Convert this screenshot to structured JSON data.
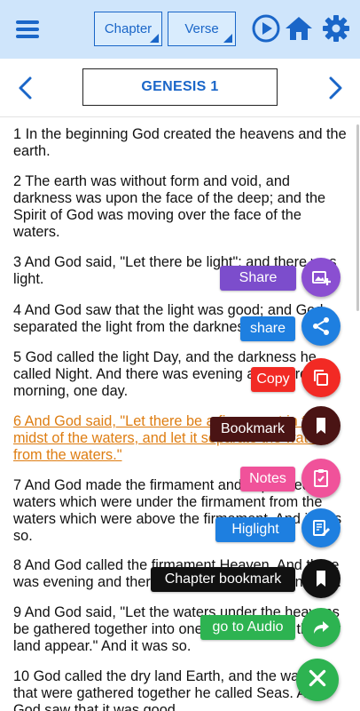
{
  "toolbar": {
    "chapter_label": "Chapter",
    "verse_label": "Verse",
    "icons": [
      "menu-icon",
      "play-circle-icon",
      "home-icon",
      "gear-icon"
    ]
  },
  "nav": {
    "title": "GENESIS 1",
    "icons": [
      "chevron-left-icon",
      "chevron-right-icon"
    ]
  },
  "verses": [
    {
      "lines": [
        "1 In the beginning God created the heavens and the",
        "earth."
      ]
    },
    {
      "lines": [
        "2 The earth was without form and void, and",
        "darkness was upon the face of the deep; and the",
        "Spirit of God was moving over the face of the",
        "waters."
      ]
    },
    {
      "lines": [
        "3 And God said, \"Let there be light\"; and there was",
        "light."
      ]
    },
    {
      "lines": [
        "4 And God saw that the light was good; and God",
        "separated the light from the darkness."
      ]
    },
    {
      "lines": [
        "5 God called the light Day, and the darkness he",
        "called Night. And there was evening and there was",
        "morning, one day."
      ]
    },
    {
      "lines": [
        "6 And God said, \"Let there be a firmament in the",
        "midst of the waters, and let it separate the waters",
        "from the waters.\""
      ],
      "highlighted": true
    },
    {
      "lines": [
        "7 And God made the firmament and separated the",
        "waters which were under the firmament from the",
        "waters which were above the firmament. And it was",
        "so."
      ]
    },
    {
      "lines": [
        "8 And God called the firmament Heaven. And there",
        "was evening and there was morning, a second day."
      ]
    },
    {
      "lines": [
        "9 And God said, \"Let the waters under the heavens",
        "be gathered together into one place, and let the dry",
        "land appear.\" And it was so."
      ]
    },
    {
      "lines": [
        "10 God called the dry land Earth, and the waters",
        "that were gathered together he called Seas. And",
        "God saw that it was good."
      ]
    }
  ],
  "actions": [
    {
      "label": "Share",
      "icon": "image-add-icon",
      "label_color": "#7c4dcc",
      "circle_color": "#8a4fd1"
    },
    {
      "label": "share",
      "icon": "share-icon",
      "label_color": "#1e7fe0",
      "circle_color": "#1e7fe0"
    },
    {
      "label": "Copy",
      "icon": "copy-icon",
      "label_color": "#f22a24",
      "circle_color": "#f22a24"
    },
    {
      "label": "Bookmark",
      "icon": "bookmark-icon",
      "label_color": "#4a1414",
      "circle_color": "#4a1414"
    },
    {
      "label": "Notes",
      "icon": "clipboard-check-icon",
      "label_color": "#f0529a",
      "circle_color": "#f0529a"
    },
    {
      "label": "Higlight",
      "icon": "edit-note-icon",
      "label_color": "#1e7fe0",
      "circle_color": "#1e7fe0"
    },
    {
      "label": "Chapter bookmark",
      "icon": "bookmark-icon",
      "label_color": "#111111",
      "circle_color": "#111111"
    },
    {
      "label": "go to Audio",
      "icon": "forward-arrow-icon",
      "label_color": "#2db351",
      "circle_color": "#2db351"
    }
  ],
  "close_icon": "close-icon",
  "colors": {
    "toolbar_bg": "#cfe5fb",
    "accent_blue": "#1a66c8",
    "highlight_text": "#de7d12",
    "fab_main": "#2db351"
  }
}
